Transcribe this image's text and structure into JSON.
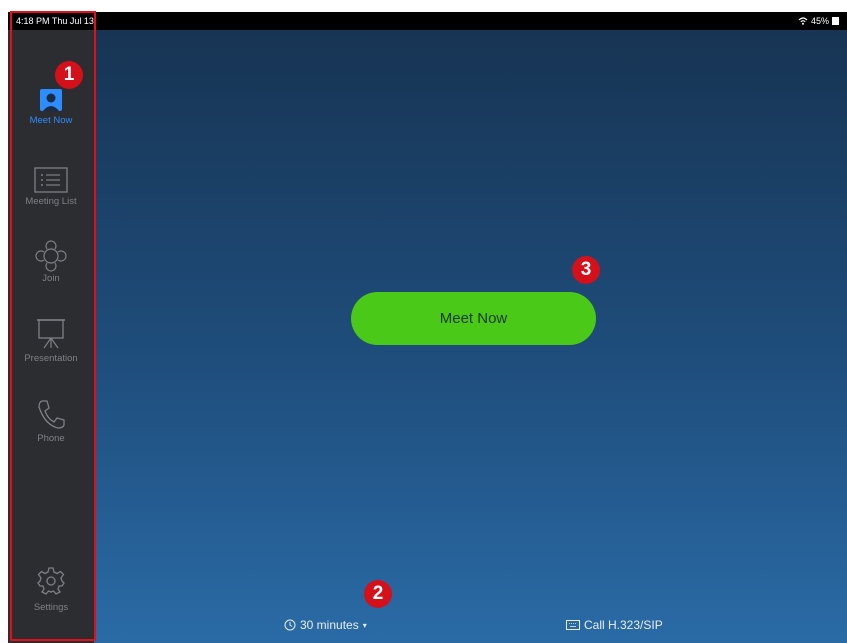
{
  "status_bar": {
    "time": "4:18 PM  Thu Jul 13",
    "battery": "45%",
    "wifi_icon": "wifi-icon"
  },
  "sidebar": {
    "items": [
      {
        "label": "Meet Now",
        "icon": "meet-now-icon",
        "active": true
      },
      {
        "label": "Meeting List",
        "icon": "meeting-list-icon",
        "active": false
      },
      {
        "label": "Join",
        "icon": "join-icon",
        "active": false
      },
      {
        "label": "Presentation",
        "icon": "presentation-icon",
        "active": false
      },
      {
        "label": "Phone",
        "icon": "phone-icon",
        "active": false
      }
    ],
    "settings": {
      "label": "Settings",
      "icon": "gear-icon"
    }
  },
  "main": {
    "meet_now_button": "Meet Now",
    "duration": "30 minutes",
    "duration_dropdown": "▾",
    "call_label": "Call H.323/SIP"
  },
  "annotations": {
    "markers": [
      "1",
      "2",
      "3"
    ],
    "highlight_color": "#e3101a"
  },
  "colors": {
    "accent": "#2d8cff",
    "meet_button": "#4bc918",
    "sidebar_bg": "#2b2d30"
  }
}
